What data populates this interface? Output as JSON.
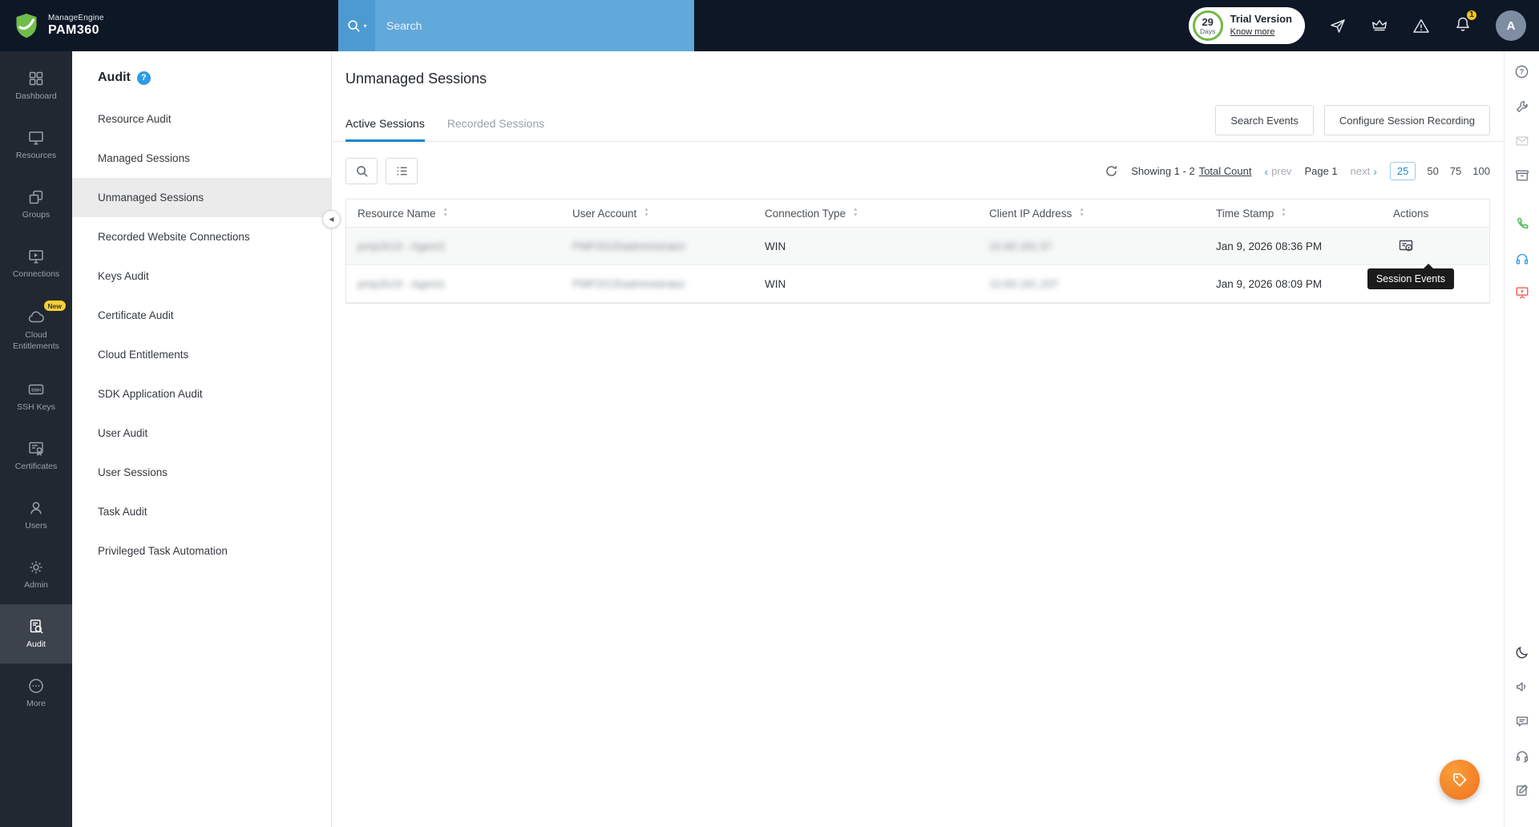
{
  "topbar": {
    "brand": {
      "manage": "Manage",
      "engine": "Engine",
      "product": "PAM360"
    },
    "search": {
      "placeholder": "Search"
    },
    "trial": {
      "days_value": "29",
      "days_unit": "Days",
      "label": "Trial Version",
      "link": "Know more"
    },
    "notifications_badge": "1",
    "avatar": "A"
  },
  "left_rail": {
    "items": [
      {
        "label": "Dashboard"
      },
      {
        "label": "Resources"
      },
      {
        "label": "Groups"
      },
      {
        "label": "Connections"
      },
      {
        "label": "Cloud Entitlements",
        "badge": "New"
      },
      {
        "label": "SSH Keys"
      },
      {
        "label": "Certificates"
      },
      {
        "label": "Users"
      },
      {
        "label": "Admin"
      },
      {
        "label": "Audit"
      },
      {
        "label": "More"
      }
    ]
  },
  "sidebar": {
    "title": "Audit",
    "items": [
      {
        "label": "Resource Audit"
      },
      {
        "label": "Managed Sessions"
      },
      {
        "label": "Unmanaged Sessions"
      },
      {
        "label": "Recorded Website Connections"
      },
      {
        "label": "Keys Audit"
      },
      {
        "label": "Certificate Audit"
      },
      {
        "label": "Cloud Entitlements"
      },
      {
        "label": "SDK Application Audit"
      },
      {
        "label": "User Audit"
      },
      {
        "label": "User Sessions"
      },
      {
        "label": "Task Audit"
      },
      {
        "label": "Privileged Task Automation"
      }
    ]
  },
  "main": {
    "title": "Unmanaged Sessions",
    "tabs": [
      {
        "label": "Active Sessions"
      },
      {
        "label": "Recorded Sessions"
      }
    ],
    "actions": {
      "search_events": "Search Events",
      "configure_recording": "Configure Session Recording"
    },
    "pagination": {
      "showing": "Showing 1 - 2",
      "total_count": "Total Count",
      "prev": "prev",
      "page": "Page 1",
      "next": "next",
      "sizes": [
        "25",
        "50",
        "75",
        "100"
      ]
    },
    "table": {
      "columns": [
        "Resource Name",
        "User Account",
        "Connection Type",
        "Client IP Address",
        "Time Stamp",
        "Actions"
      ],
      "rows": [
        {
          "resource_name": "pmp2k19 - Agent1",
          "user_account": "PMP2019\\administrator",
          "connection_type": "WIN",
          "client_ip": "10.69.181.97",
          "time_stamp": "Jan 9, 2026 08:36 PM"
        },
        {
          "resource_name": "pmp2k19 - Agent1",
          "user_account": "PMP2019\\administrator",
          "connection_type": "WIN",
          "client_ip": "10.69.181.207",
          "time_stamp": "Jan 9, 2026 08:09 PM"
        }
      ]
    },
    "tooltip": "Session Events"
  }
}
